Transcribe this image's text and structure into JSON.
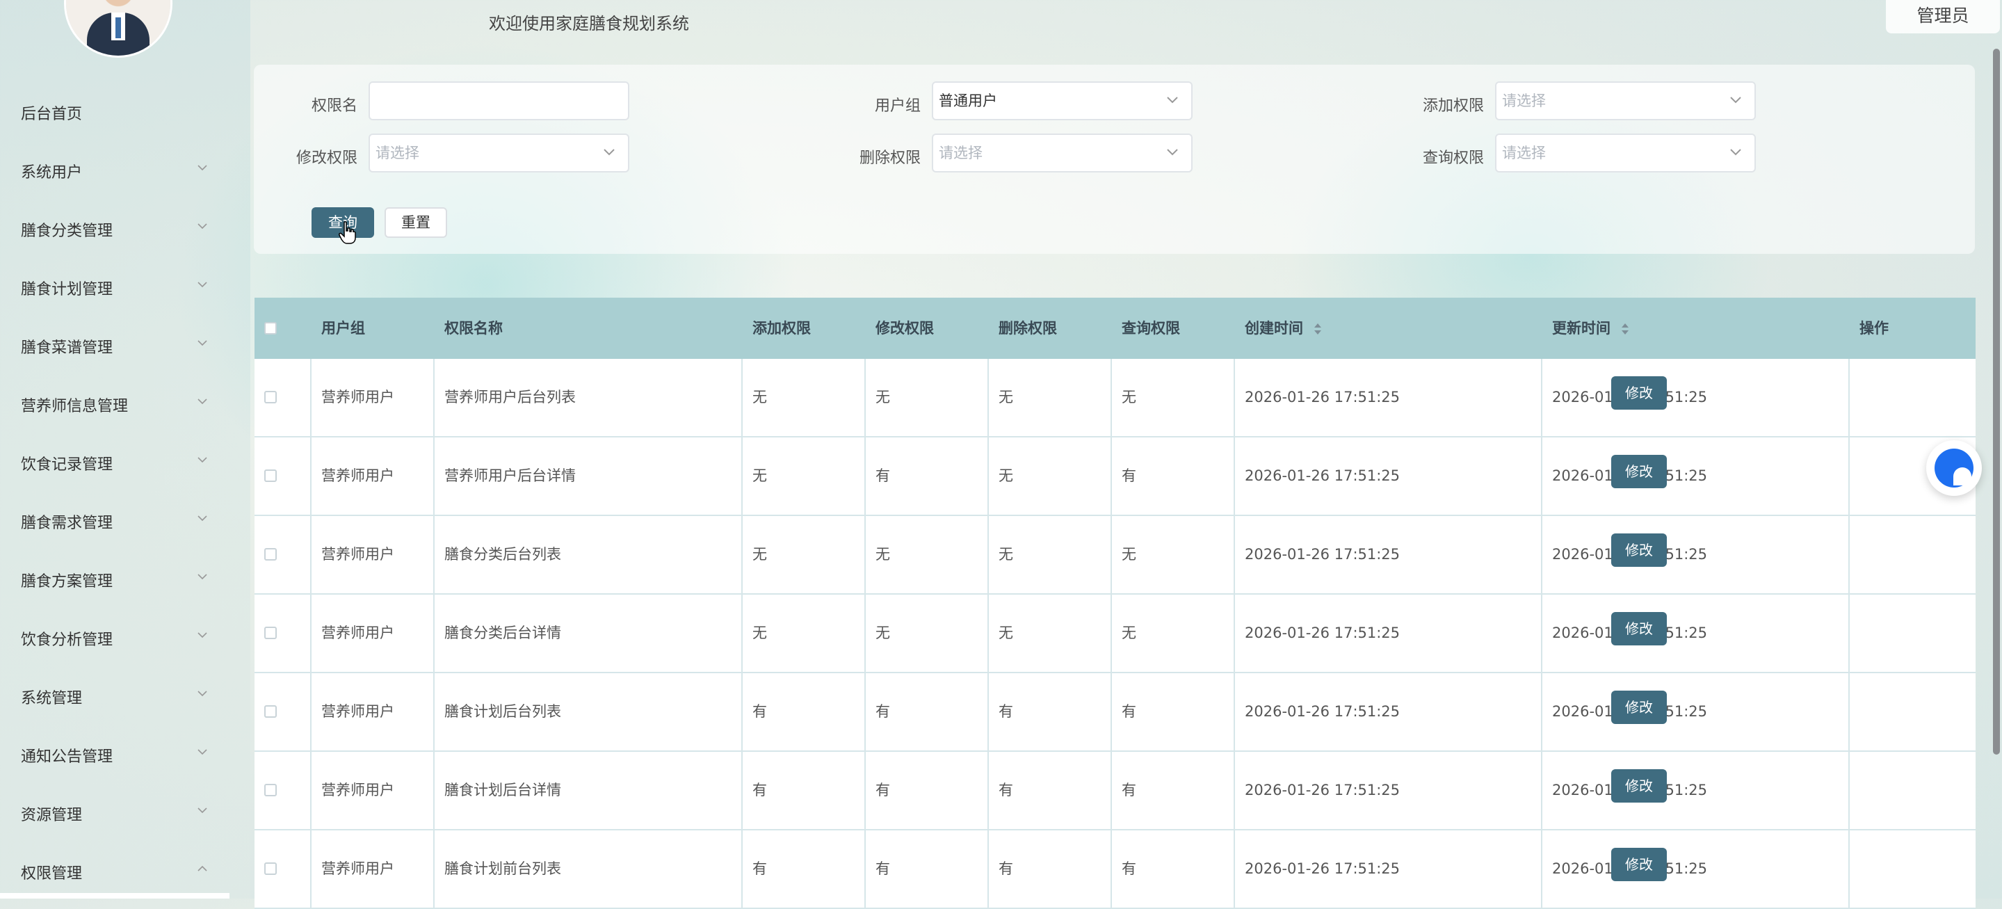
{
  "header": {
    "welcome": "欢迎使用家庭膳食规划系统",
    "admin_label": "管理员"
  },
  "sidebar": {
    "items": [
      {
        "label": "后台首页",
        "has_chevron": false
      },
      {
        "label": "系统用户",
        "has_chevron": true
      },
      {
        "label": "膳食分类管理",
        "has_chevron": true
      },
      {
        "label": "膳食计划管理",
        "has_chevron": true
      },
      {
        "label": "膳食菜谱管理",
        "has_chevron": true
      },
      {
        "label": "营养师信息管理",
        "has_chevron": true
      },
      {
        "label": "饮食记录管理",
        "has_chevron": true
      },
      {
        "label": "膳食需求管理",
        "has_chevron": true
      },
      {
        "label": "膳食方案管理",
        "has_chevron": true
      },
      {
        "label": "饮食分析管理",
        "has_chevron": true
      },
      {
        "label": "系统管理",
        "has_chevron": true
      },
      {
        "label": "通知公告管理",
        "has_chevron": true
      },
      {
        "label": "资源管理",
        "has_chevron": true
      },
      {
        "label": "权限管理",
        "has_chevron": true,
        "expanded": true
      }
    ]
  },
  "filters": {
    "perm_name": {
      "label": "权限名",
      "value": ""
    },
    "user_group": {
      "label": "用户组",
      "value": "普通用户"
    },
    "add_perm": {
      "label": "添加权限",
      "placeholder": "请选择"
    },
    "edit_perm": {
      "label": "修改权限",
      "placeholder": "请选择"
    },
    "delete_perm": {
      "label": "删除权限",
      "placeholder": "请选择"
    },
    "query_perm": {
      "label": "查询权限",
      "placeholder": "请选择"
    },
    "query_button": "查询",
    "reset_button": "重置"
  },
  "table": {
    "headers": {
      "user_group": "用户组",
      "perm_name": "权限名称",
      "add": "添加权限",
      "edit": "修改权限",
      "delete": "删除权限",
      "query": "查询权限",
      "created": "创建时间",
      "updated": "更新时间",
      "actions": "操作"
    },
    "edit_label": "修改",
    "rows": [
      {
        "user_group": "营养师用户",
        "perm_name": "营养师用户后台列表",
        "add": "无",
        "edit": "无",
        "delete": "无",
        "query": "无",
        "created": "2026-01-26 17:51:25",
        "updated": "2026-01-26 17:51:25"
      },
      {
        "user_group": "营养师用户",
        "perm_name": "营养师用户后台详情",
        "add": "无",
        "edit": "有",
        "delete": "无",
        "query": "有",
        "created": "2026-01-26 17:51:25",
        "updated": "2026-01-26 17:51:25"
      },
      {
        "user_group": "营养师用户",
        "perm_name": "膳食分类后台列表",
        "add": "无",
        "edit": "无",
        "delete": "无",
        "query": "无",
        "created": "2026-01-26 17:51:25",
        "updated": "2026-01-26 17:51:25"
      },
      {
        "user_group": "营养师用户",
        "perm_name": "膳食分类后台详情",
        "add": "无",
        "edit": "无",
        "delete": "无",
        "query": "无",
        "created": "2026-01-26 17:51:25",
        "updated": "2026-01-26 17:51:25"
      },
      {
        "user_group": "营养师用户",
        "perm_name": "膳食计划后台列表",
        "add": "有",
        "edit": "有",
        "delete": "有",
        "query": "有",
        "created": "2026-01-26 17:51:25",
        "updated": "2026-01-26 17:51:25"
      },
      {
        "user_group": "营养师用户",
        "perm_name": "膳食计划后台详情",
        "add": "有",
        "edit": "有",
        "delete": "有",
        "query": "有",
        "created": "2026-01-26 17:51:25",
        "updated": "2026-01-26 17:51:25"
      },
      {
        "user_group": "营养师用户",
        "perm_name": "膳食计划前台列表",
        "add": "有",
        "edit": "有",
        "delete": "有",
        "query": "有",
        "created": "2026-01-26 17:51:25",
        "updated": "2026-01-26 17:51:25"
      }
    ]
  },
  "colors": {
    "primary": "#3f6c80",
    "table_header": "#a9cfd2",
    "float_button": "#1e6ff0"
  }
}
